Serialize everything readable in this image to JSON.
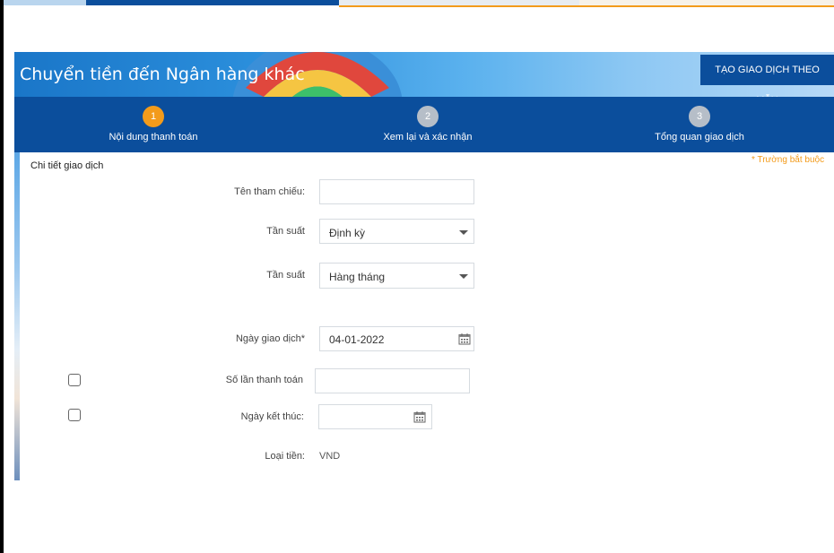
{
  "page": {
    "title": "Chuyển tiền đến Ngân hàng khác",
    "template_button": "TẠO GIAO DỊCH THEO MẪU"
  },
  "steps": [
    {
      "number": "1",
      "label": "Nội dung thanh toán",
      "active": true
    },
    {
      "number": "2",
      "label": "Xem lại và xác nhận",
      "active": false
    },
    {
      "number": "3",
      "label": "Tổng quan giao dịch",
      "active": false
    }
  ],
  "form": {
    "section_title": "Chi tiết giao dịch",
    "required_note": "* Trường bắt buộc",
    "reference_label": "Tên tham chiếu:",
    "reference_value": "",
    "frequency_label": "Tần suất",
    "frequency_value": "Định kỳ",
    "frequency2_label": "Tần suất",
    "frequency2_value": "Hàng tháng",
    "transaction_date_label": "Ngày giao dịch*",
    "transaction_date_value": "04-01-2022",
    "payment_count_label": "Số lần thanh toán",
    "payment_count_value": "",
    "end_date_label": "Ngày kết thúc:",
    "end_date_value": "",
    "currency_label": "Loại tiền:",
    "currency_value": "VND"
  },
  "colors": {
    "primary": "#0b4e9c",
    "accent": "#f39b1b",
    "inactive_step": "#b6bec8"
  }
}
